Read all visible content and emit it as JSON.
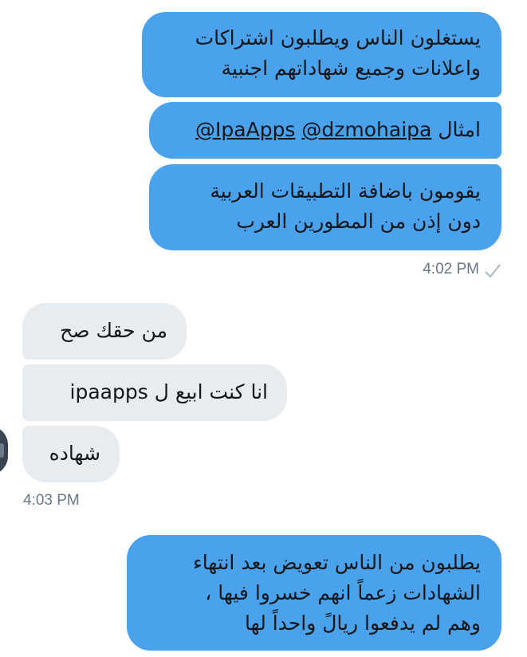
{
  "conversation": {
    "messages": [
      {
        "direction": "outgoing",
        "lines": [
          "يستغلون الناس ويطلبون اشتراكات",
          "واعلانات وجميع شهاداتهم اجنبية"
        ]
      },
      {
        "direction": "outgoing",
        "prefix": "امثال",
        "mentions": [
          "@dzmohaipa",
          "@IpaApps"
        ]
      },
      {
        "direction": "outgoing",
        "lines": [
          "يقومون باضافة التطبيقات العربية",
          "دون إذن من المطورين العرب"
        ]
      },
      {
        "direction": "incoming",
        "text": "من حقك صح"
      },
      {
        "direction": "incoming",
        "text": "انا كنت ابيع ل ipaapps"
      },
      {
        "direction": "incoming",
        "text": "شهاده"
      },
      {
        "direction": "outgoing",
        "lines": [
          "يطلبون من الناس تعويض بعد انتهاء",
          "الشهادات زعماً انهم خسروا فيها ،",
          "وهم لم يدفعوا ريالً واحداً لها"
        ]
      }
    ],
    "timestamps": {
      "outgoing_group": "4:02 PM",
      "incoming_group": "4:03 PM"
    }
  },
  "colors": {
    "outgoing_bubble": "#4aa1ec",
    "incoming_bubble": "#e6ecf0",
    "timestamp_text": "#657786",
    "link_text": "#14171a"
  },
  "icons": {
    "read_receipt": "check-icon"
  }
}
